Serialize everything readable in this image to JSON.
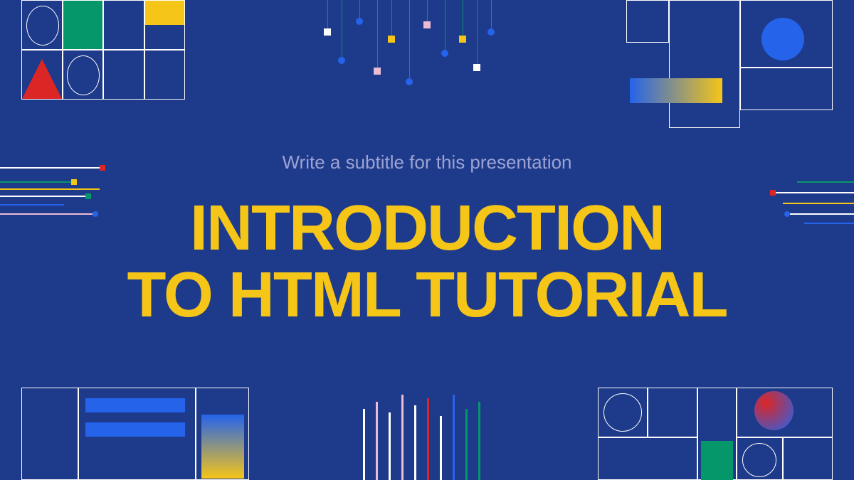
{
  "slide": {
    "subtitle": "Write a subtitle for this presentation",
    "title_line1": "INTRODUCTION",
    "title_line2": "TO HTML TUTORIAL"
  },
  "colors": {
    "background": "#1e3a8a",
    "title": "#f5c518",
    "subtitle": "#9ca3d4",
    "accent_green": "#059669",
    "accent_red": "#dc2626",
    "accent_blue": "#2563eb",
    "accent_pink": "#ecbcd5"
  }
}
